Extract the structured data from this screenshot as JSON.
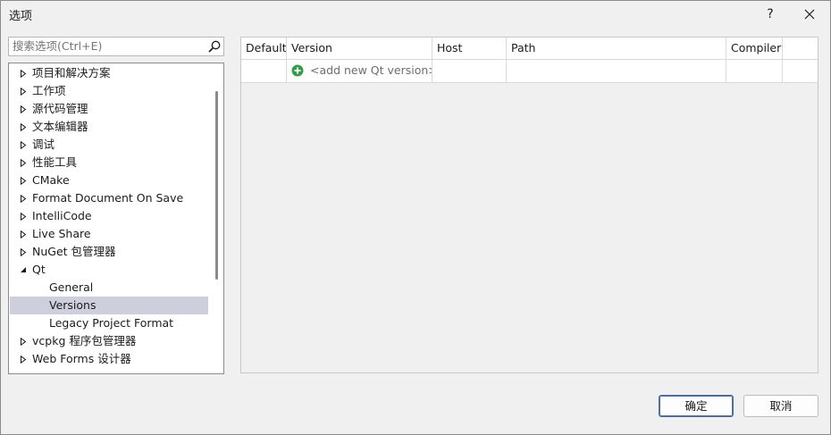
{
  "window": {
    "title": "选项",
    "help_label": "?",
    "close_label": "✕"
  },
  "search": {
    "placeholder": "搜索选项(Ctrl+E)"
  },
  "tree": {
    "items": [
      {
        "label": "项目和解决方案",
        "expander": "collapsed",
        "level": 0
      },
      {
        "label": "工作项",
        "expander": "collapsed",
        "level": 0
      },
      {
        "label": "源代码管理",
        "expander": "collapsed",
        "level": 0
      },
      {
        "label": "文本编辑器",
        "expander": "collapsed",
        "level": 0
      },
      {
        "label": "调试",
        "expander": "collapsed",
        "level": 0
      },
      {
        "label": "性能工具",
        "expander": "collapsed",
        "level": 0
      },
      {
        "label": "CMake",
        "expander": "collapsed",
        "level": 0
      },
      {
        "label": "Format Document On Save",
        "expander": "collapsed",
        "level": 0
      },
      {
        "label": "IntelliCode",
        "expander": "collapsed",
        "level": 0
      },
      {
        "label": "Live Share",
        "expander": "collapsed",
        "level": 0
      },
      {
        "label": "NuGet 包管理器",
        "expander": "collapsed",
        "level": 0
      },
      {
        "label": "Qt",
        "expander": "expanded",
        "level": 0
      },
      {
        "label": "General",
        "expander": "none",
        "level": 1
      },
      {
        "label": "Versions",
        "expander": "none",
        "level": 1,
        "selected": true
      },
      {
        "label": "Legacy Project Format",
        "expander": "none",
        "level": 1
      },
      {
        "label": "vcpkg 程序包管理器",
        "expander": "collapsed",
        "level": 0
      },
      {
        "label": "Web Forms 设计器",
        "expander": "collapsed",
        "level": 0
      }
    ]
  },
  "grid": {
    "columns": [
      "Default",
      "Version",
      "Host",
      "Path",
      "Compiler",
      ""
    ],
    "add_row_label": "<add new Qt version>"
  },
  "buttons": {
    "ok": "确定",
    "cancel": "取消"
  },
  "colors": {
    "selection": "#cdd0dc",
    "add_icon": "#2f9e44",
    "ok_border": "#4a6fa8"
  }
}
